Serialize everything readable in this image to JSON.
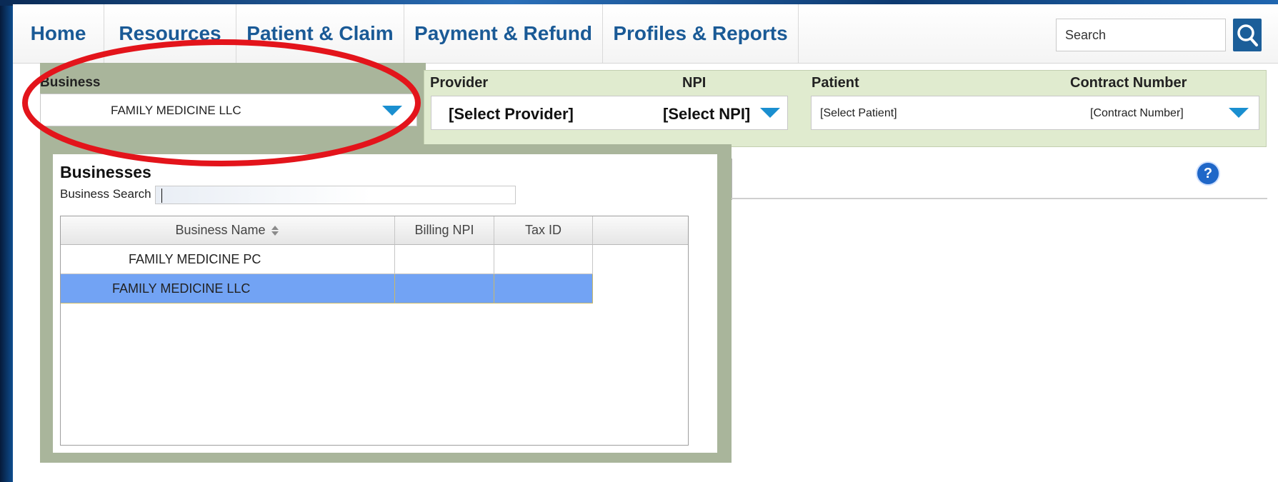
{
  "nav": {
    "items": [
      {
        "label": "Home"
      },
      {
        "label": "Resources"
      },
      {
        "label": "Patient & Claim"
      },
      {
        "label": "Payment & Refund"
      },
      {
        "label": "Profiles & Reports"
      }
    ],
    "search_value": "Search"
  },
  "selectors": {
    "business": {
      "label": "Business",
      "value": "FAMILY MEDICINE LLC"
    },
    "provider": {
      "label": "Provider",
      "value": "[Select Provider]"
    },
    "npi": {
      "label": "NPI",
      "value": "[Select NPI]"
    },
    "patient": {
      "label": "Patient",
      "value": "[Select Patient]"
    },
    "contract": {
      "label": "Contract Number",
      "value": "[Contract Number]"
    }
  },
  "businesses_popup": {
    "title": "Businesses",
    "search_label": "Business Search",
    "search_value": "",
    "columns": [
      "Business Name",
      "Billing NPI",
      "Tax ID"
    ],
    "rows": [
      {
        "name": "FAMILY MEDICINE PC",
        "npi": "",
        "tax_id": "",
        "selected": false
      },
      {
        "name": "FAMILY MEDICINE LLC",
        "npi": "",
        "tax_id": "",
        "selected": true
      }
    ]
  },
  "colors": {
    "nav_text": "#1a5a96",
    "selector_bg": "#e0ebcf",
    "panel_bg": "#a9b59b",
    "selected_row": "#72a3f4",
    "caret": "#1a8fd0",
    "annotation": "#e3141b"
  },
  "icons": {
    "search": "magnifier-icon",
    "help": "question-icon",
    "sort": "sort-icon",
    "dropdown": "caret-down-icon"
  }
}
